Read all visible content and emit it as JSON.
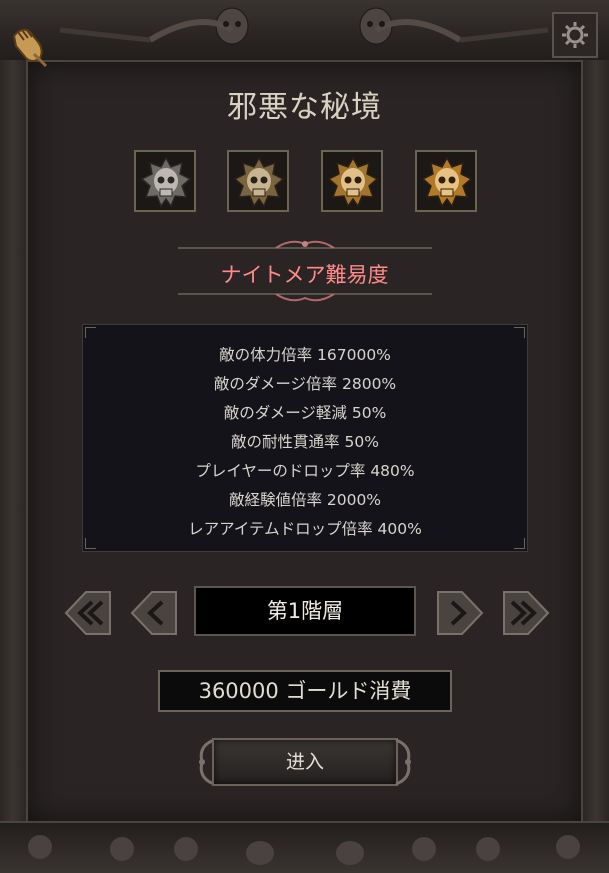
{
  "dungeon": {
    "title": "邪悪な秘境",
    "difficulty_label": "ナイトメア難易度",
    "difficulty_color": "#ff8a8a",
    "skull_icons": [
      "skull-silver-icon",
      "skull-bronze-icon",
      "skull-gold-icon",
      "skull-gold-icon"
    ],
    "stats": [
      "敵の体力倍率 167000%",
      "敵のダメージ倍率 2800%",
      "敵のダメージ軽減 50%",
      "敵の耐性貫通率 50%",
      "プレイヤーのドロップ率 480%",
      "敵経験値倍率 2000%",
      "レアアイテムドロップ倍率 400%"
    ],
    "floor_label": "第1階層",
    "cost_label": "360000 ゴールド消費",
    "enter_label": "进入"
  },
  "colors": {
    "title": "#d9d2c3",
    "panel": "#2a2524",
    "stats_bg": "#14131a"
  }
}
